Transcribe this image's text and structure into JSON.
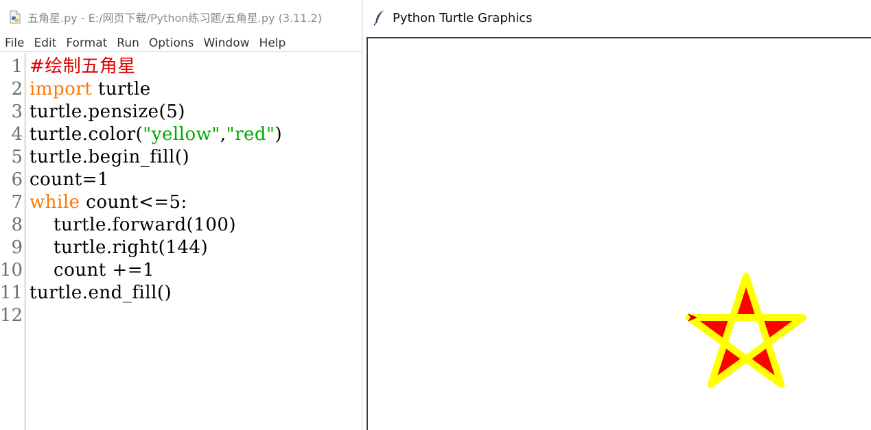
{
  "idle": {
    "title": "五角星.py - E:/网页下载/Python练习题/五角星.py (3.11.2)",
    "menu": [
      "File",
      "Edit",
      "Format",
      "Run",
      "Options",
      "Window",
      "Help"
    ],
    "line_numbers": [
      "1",
      "2",
      "3",
      "4",
      "5",
      "6",
      "7",
      "8",
      "9",
      "10",
      "11",
      "12"
    ],
    "code": [
      [
        {
          "t": "#绘制五角星",
          "c": "comment"
        }
      ],
      [
        {
          "t": "import",
          "c": "keyword"
        },
        {
          "t": " turtle",
          "c": ""
        }
      ],
      [
        {
          "t": "turtle.pensize(5)",
          "c": ""
        }
      ],
      [
        {
          "t": "turtle.color(",
          "c": ""
        },
        {
          "t": "\"yellow\"",
          "c": "string"
        },
        {
          "t": ",",
          "c": ""
        },
        {
          "t": "\"red\"",
          "c": "string"
        },
        {
          "t": ")",
          "c": ""
        }
      ],
      [
        {
          "t": "turtle.begin_fill()",
          "c": ""
        }
      ],
      [
        {
          "t": "count=1",
          "c": ""
        }
      ],
      [
        {
          "t": "while",
          "c": "keyword"
        },
        {
          "t": " count<=5:",
          "c": ""
        }
      ],
      [
        {
          "t": "    turtle.forward(100)",
          "c": ""
        }
      ],
      [
        {
          "t": "    turtle.right(144)",
          "c": ""
        }
      ],
      [
        {
          "t": "    count +=1",
          "c": ""
        }
      ],
      [
        {
          "t": "turtle.end_fill()",
          "c": ""
        }
      ],
      [
        {
          "t": "",
          "c": ""
        }
      ]
    ]
  },
  "turtle": {
    "title": "Python Turtle Graphics",
    "star": {
      "pen_color": "#ffff00",
      "fill_color": "#ff0000",
      "pen_size": 5,
      "side": 100,
      "turn_angle": 144
    },
    "cursor_color": "#cc0000"
  },
  "colors": {
    "comment": "#dd0000",
    "keyword": "#ff7700",
    "string": "#00aa00"
  },
  "icons": [
    "python-file-icon",
    "feather-icon"
  ]
}
